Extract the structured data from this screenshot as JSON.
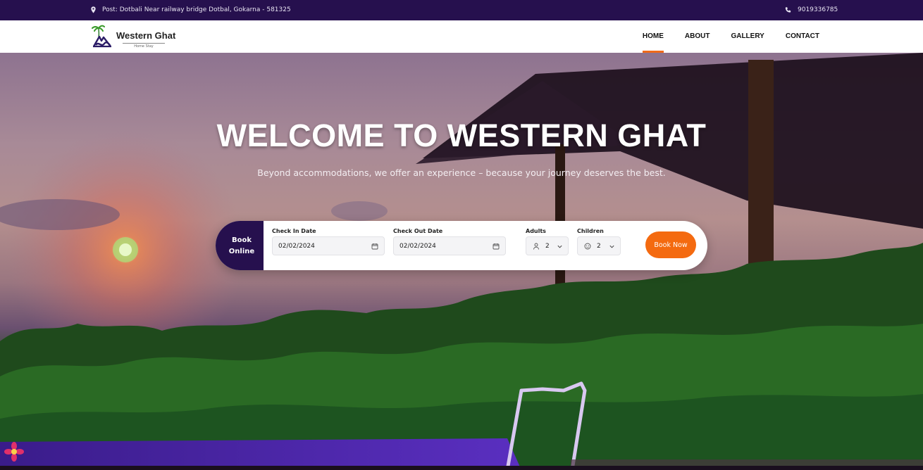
{
  "topbar": {
    "address": "Post: Dotbali Near railway bridge Dotbal, Gokarna - 581325",
    "phone": "9019336785",
    "address_icon": "location-pin-icon",
    "phone_icon": "phone-icon"
  },
  "header": {
    "brand_name": "Western Ghat",
    "brand_tagline": "Home Stay",
    "nav": [
      {
        "label": "HOME",
        "active": true
      },
      {
        "label": "ABOUT",
        "active": false
      },
      {
        "label": "GALLERY",
        "active": false
      },
      {
        "label": "CONTACT",
        "active": false
      }
    ]
  },
  "hero": {
    "title": "WELCOME TO WESTERN GHAT",
    "subtitle": "Beyond accommodations, we offer an experience – because your journey deserves the best."
  },
  "booking": {
    "tab_line1": "Book",
    "tab_line2": "Online",
    "checkin_label": "Check In Date",
    "checkin_value": "02/02/2024",
    "checkout_label": "Check Out Date",
    "checkout_value": "02/02/2024",
    "adults_label": "Adults",
    "adults_value": "2",
    "children_label": "Children",
    "children_value": "2",
    "button_label": "Book Now"
  },
  "colors": {
    "brand_purple": "#26104e",
    "accent_orange": "#f46a10",
    "nav_underline": "#f06a1a"
  }
}
